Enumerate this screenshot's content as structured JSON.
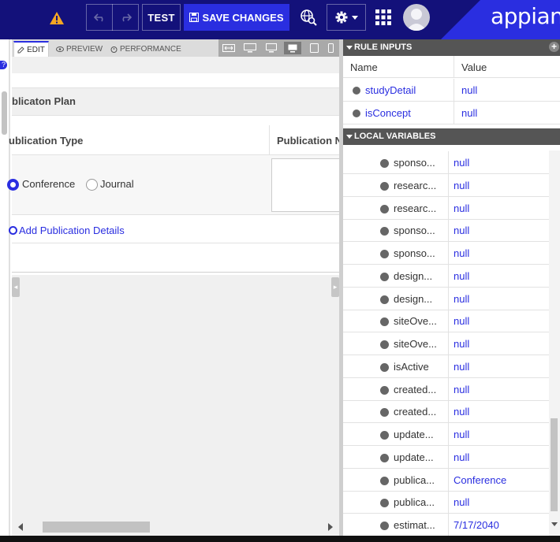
{
  "toolbar": {
    "test_label": "TEST",
    "save_label": "SAVE CHANGES",
    "brand": "appian"
  },
  "designer": {
    "tabs": [
      {
        "label": "EDIT",
        "icon": "pencil-icon"
      },
      {
        "label": "PREVIEW",
        "icon": "eye-icon"
      },
      {
        "label": "PERFORMANCE",
        "icon": "stopwatch-icon"
      }
    ],
    "section_title": "blicaton Plan",
    "grid_headers": [
      "ublication Type",
      "Publication N"
    ],
    "radio_options": [
      {
        "label": "Conference",
        "selected": true
      },
      {
        "label": "Journal",
        "selected": false
      }
    ],
    "add_link": "Add Publication Details"
  },
  "rule_inputs": {
    "title": "RULE INPUTS",
    "col_name": "Name",
    "col_value": "Value",
    "rows": [
      {
        "name": "studyDetail",
        "value": "null"
      },
      {
        "name": "isConcept",
        "value": "null"
      }
    ]
  },
  "local_variables": {
    "title": "LOCAL VARIABLES",
    "rows": [
      {
        "name": "sponso...",
        "value": "null"
      },
      {
        "name": "researc...",
        "value": "null"
      },
      {
        "name": "researc...",
        "value": "null"
      },
      {
        "name": "sponso...",
        "value": "null"
      },
      {
        "name": "sponso...",
        "value": "null"
      },
      {
        "name": "design...",
        "value": "null"
      },
      {
        "name": "design...",
        "value": "null"
      },
      {
        "name": "siteOve...",
        "value": "null"
      },
      {
        "name": "siteOve...",
        "value": "null"
      },
      {
        "name": "isActive",
        "value": "null"
      },
      {
        "name": "created...",
        "value": "null"
      },
      {
        "name": "created...",
        "value": "null"
      },
      {
        "name": "update...",
        "value": "null"
      },
      {
        "name": "update...",
        "value": "null"
      },
      {
        "name": "publica...",
        "value": "Conference"
      },
      {
        "name": "publica...",
        "value": "null"
      },
      {
        "name": "estimat...",
        "value": "7/17/2040"
      }
    ]
  },
  "colors": {
    "toolbar_bg": "#13117a",
    "accent": "#2a2ee0",
    "panel_header": "#555555"
  }
}
